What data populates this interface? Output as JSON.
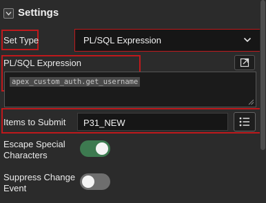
{
  "section": {
    "title": "Settings"
  },
  "set_type": {
    "label": "Set Type",
    "value": "PL/SQL Expression"
  },
  "plsql_expression": {
    "label": "PL/SQL Expression",
    "code": "apex_custom_auth.get_username"
  },
  "items_to_submit": {
    "label": "Items to Submit",
    "value": "P31_NEW"
  },
  "escape_special_characters": {
    "label_line1": "Escape Special",
    "label_line2": "Characters",
    "enabled": true
  },
  "suppress_change_event": {
    "label_line1": "Suppress Change",
    "label_line2": "Event",
    "enabled": false
  },
  "colors": {
    "highlight": "#c0191c",
    "toggle_on": "#3d7a50",
    "toggle_off": "#6e6e6e"
  }
}
